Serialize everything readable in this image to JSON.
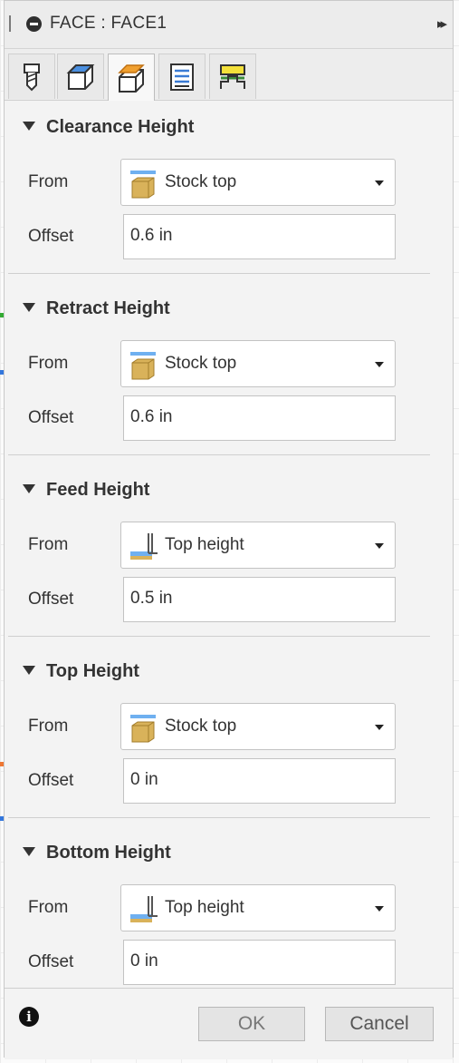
{
  "window": {
    "title": "FACE : FACE1"
  },
  "tabs": [
    {
      "name": "tool",
      "icon": "tool-icon"
    },
    {
      "name": "geometry",
      "icon": "geometry-icon"
    },
    {
      "name": "heights",
      "icon": "heights-icon",
      "active": true
    },
    {
      "name": "passes",
      "icon": "passes-icon"
    },
    {
      "name": "linking",
      "icon": "linking-icon"
    }
  ],
  "sections": [
    {
      "title": "Clearance Height",
      "from_label": "From",
      "from_value": "Stock top",
      "from_icon": "stock-top-icon",
      "offset_label": "Offset",
      "offset_value": "0.6 in"
    },
    {
      "title": "Retract Height",
      "from_label": "From",
      "from_value": "Stock top",
      "from_icon": "stock-top-icon",
      "offset_label": "Offset",
      "offset_value": "0.6 in"
    },
    {
      "title": "Feed Height",
      "from_label": "From",
      "from_value": "Top height",
      "from_icon": "top-height-icon",
      "offset_label": "Offset",
      "offset_value": "0.5 in"
    },
    {
      "title": "Top Height",
      "from_label": "From",
      "from_value": "Stock top",
      "from_icon": "stock-top-icon",
      "offset_label": "Offset",
      "offset_value": "0 in"
    },
    {
      "title": "Bottom Height",
      "from_label": "From",
      "from_value": "Top height",
      "from_icon": "top-height-icon",
      "offset_label": "Offset",
      "offset_value": "0 in"
    }
  ],
  "footer": {
    "ok_label": "OK",
    "cancel_label": "Cancel",
    "info_symbol": "i"
  },
  "colors": {
    "accent_orange": "#f0a030",
    "accent_blue": "#3a7bd5",
    "stock_tan": "#d9b25a"
  }
}
